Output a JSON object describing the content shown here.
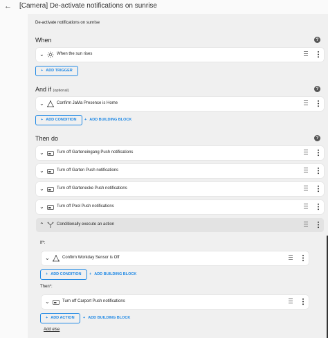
{
  "header": {
    "back_icon": "arrow-left-icon",
    "title": "[Camera] De-activate notifications on sunrise"
  },
  "description": "De-activate notifications on sunrise",
  "help_icon": "help-circle-icon",
  "when": {
    "heading": "When",
    "triggers": [
      {
        "label": "When the sun rises",
        "icon": "sun-icon"
      }
    ],
    "add_trigger": "ADD TRIGGER"
  },
  "and_if": {
    "heading": "And if",
    "optional": "(optional)",
    "conditions": [
      {
        "label": "Confirm JaMa Presence is Home",
        "icon": "condition-triangle-icon"
      }
    ],
    "add_condition": "ADD CONDITION",
    "add_building_block": "ADD BUILDING BLOCK"
  },
  "then_do": {
    "heading": "Then do",
    "actions": [
      {
        "label": "Turn off Garteneingang Push notifications",
        "icon": "toggle-off-icon"
      },
      {
        "label": "Turn off Garten Push notifications",
        "icon": "toggle-off-icon"
      },
      {
        "label": "Turn off Gartenecke Push notifications",
        "icon": "toggle-off-icon"
      },
      {
        "label": "Turn off Pool Push notifications",
        "icon": "toggle-off-icon"
      },
      {
        "label": "Conditionally execute an action",
        "icon": "branch-icon"
      }
    ],
    "conditional": {
      "if_label": "If*:",
      "condition": "Confirm Workday Sensor is Off",
      "add_condition": "ADD CONDITION",
      "add_building_block": "ADD BUILDING BLOCK",
      "then_label": "Then*:",
      "action": "Turn off Carport Push notifications",
      "add_action": "ADD ACTION",
      "add_building_block_2": "ADD BUILDING BLOCK",
      "add_else": "Add else"
    }
  },
  "colors": {
    "accent": "#1e88e5",
    "background": "#f0f0f0",
    "card": "#ffffff"
  }
}
